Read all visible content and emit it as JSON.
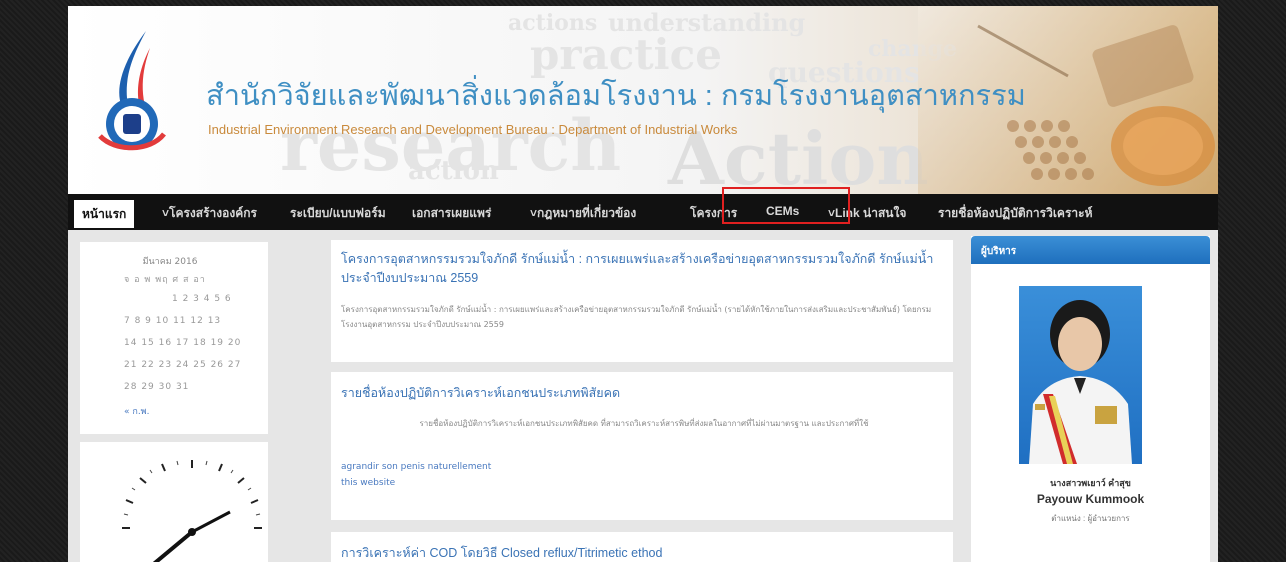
{
  "header": {
    "title_th": "สำนักวิจัยและพัฒนาสิ่งแวดล้อมโรงงาน : กรมโรงงานอุตสาหกรรม",
    "title_en": "Industrial Environment Research and Development Bureau : Department of Industrial Works",
    "watermark_words": [
      "research",
      "understanding",
      "practice",
      "action",
      "questions",
      "change",
      "actions",
      "Action"
    ]
  },
  "nav": {
    "items": [
      "หน้าแรก",
      "˅โครงสร้างองค์กร",
      "ระเบียบ/แบบฟอร์ม",
      "เอกสารเผยแพร่",
      "˅กฎหมายที่เกี่ยวข้อง",
      "โครงการ",
      "CEMs",
      "˅Link น่าสนใจ",
      "รายชื่อห้องปฏิบัติการวิเคราะห์"
    ]
  },
  "calendar": {
    "month": "มีนาคม 2016",
    "weekdays": "จ  อ  พ  พฤ  ศ  ส  อา",
    "rows": [
      "1   2   3   4   5   6",
      "7   8   9  10  11  12  13",
      "14  15  16  17  18  19  20",
      "21  22  23  24  25  26  27",
      "28  29  30  31"
    ],
    "prev": "« ก.พ."
  },
  "posts": [
    {
      "title": "โครงการอุตสาหกรรมรวมใจภักดี รักษ์แม่น้ำ : การเผยแพร่และสร้างเครือข่ายอุตสาหกรรมรวมใจภักดี รักษ์แม่น้ำ ประจำปีงบประมาณ 2559",
      "body": "โครงการอุตสาหกรรมรวมใจภักดี รักษ์แม่น้ำ : การเผยแพร่และสร้างเครือข่ายอุตสาหกรรมรวมใจภักดี รักษ์แม่น้ำ (รายได้หักใช้ภายในการส่งเสริมและประชาสัมพันธ์) โดยกรมโรงงานอุตสาหกรรม ประจำปีงบประมาณ 2559"
    },
    {
      "title": "รายชื่อห้องปฏิบัติการวิเคราะห์เอกชนประเภทพิสัยคด",
      "body": "รายชื่อห้องปฏิบัติการวิเคราะห์เอกชนประเภทพิสัยคด ที่สามารถวิเคราะห์สารพิษที่ส่งผลในอากาศที่ไม่ผ่านมาตรฐาน และประกาศที่ใช้",
      "links": [
        "agrandir son penis naturellement",
        "this website"
      ]
    },
    {
      "title": "การวิเคราะห์ค่า COD โดยวิธี Closed reflux/Titrimetic ethod"
    }
  ],
  "executive": {
    "heading": "ผู้บริหาร",
    "name_th": "นางสาวพเยาว์ คำสุข",
    "name_en": "Payouw Kummook",
    "position": "ตำแหน่ง : ผู้อำนวยการ"
  },
  "colors": {
    "title": "#3f8fc3",
    "subtitle": "#c98a3c",
    "nav_bg": "#111111",
    "link": "#3a73b5",
    "highlight": "#e02020",
    "panel_head": "#2b80cc"
  }
}
